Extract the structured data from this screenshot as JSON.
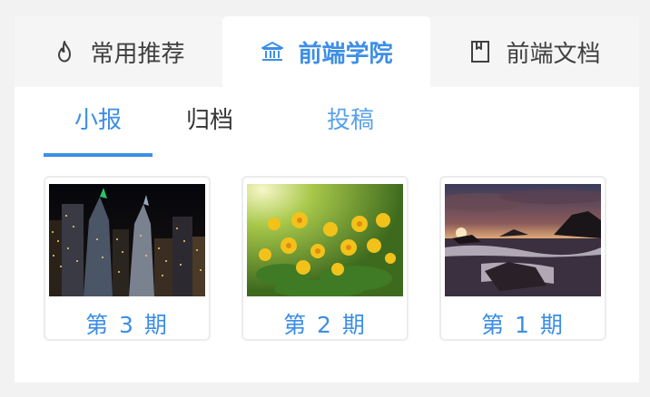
{
  "top_tabs": [
    {
      "label": "常用推荐",
      "icon": "flame-icon",
      "active": false
    },
    {
      "label": "前端学院",
      "icon": "institution-icon",
      "active": true
    },
    {
      "label": "前端文档",
      "icon": "book-icon",
      "active": false
    }
  ],
  "sub_tabs": [
    {
      "label": "小报",
      "active": true
    },
    {
      "label": "归档",
      "active": false
    },
    {
      "label": "投稿",
      "active": false
    }
  ],
  "issues": [
    {
      "label": "第 3 期",
      "image": "city-night-skyline"
    },
    {
      "label": "第 2 期",
      "image": "yellow-flowers"
    },
    {
      "label": "第 1 期",
      "image": "seashore-sunset"
    }
  ],
  "colors": {
    "accent": "#3d8ee6",
    "tab_bar_bg": "#f5f5f5",
    "page_bg": "#f2f2f2"
  }
}
